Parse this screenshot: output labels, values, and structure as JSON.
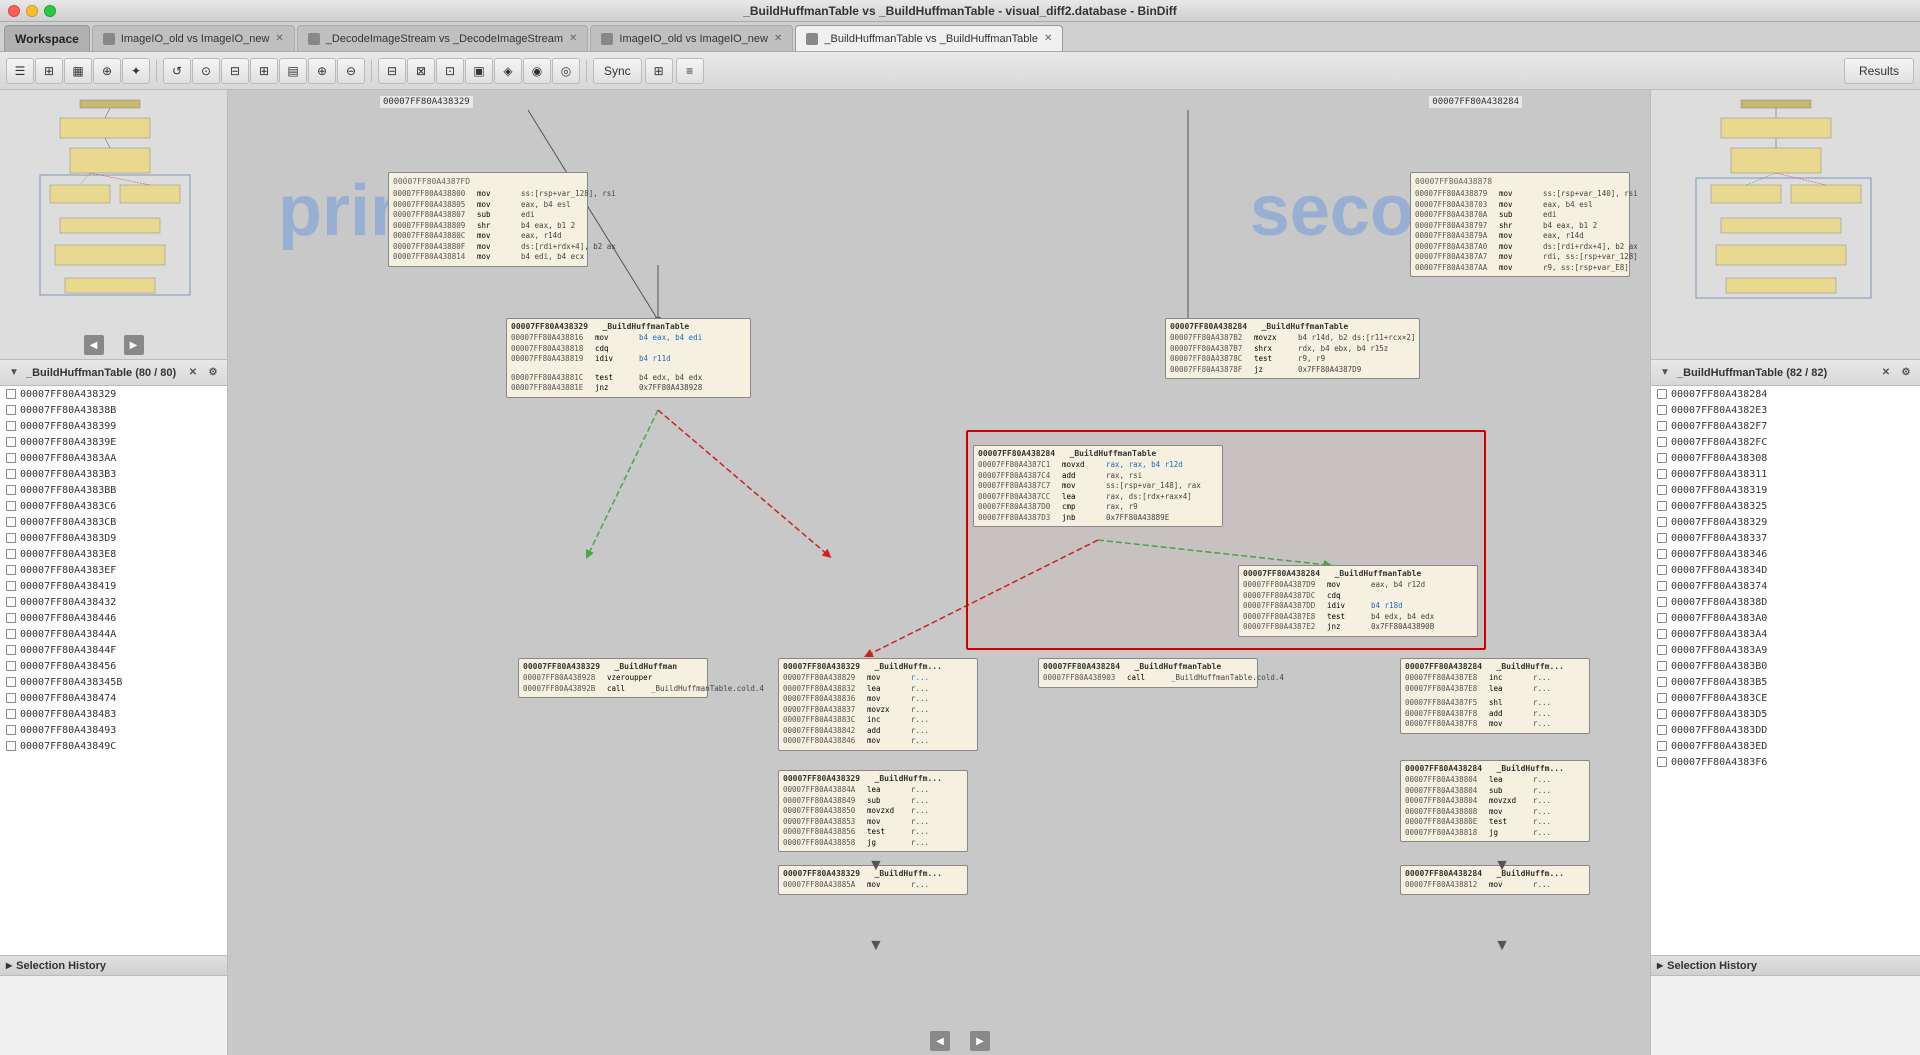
{
  "window": {
    "title": "_BuildHuffmanTable vs _BuildHuffmanTable - visual_diff2.database - BinDiff",
    "controls": {
      "close": "close",
      "minimize": "minimize",
      "maximize": "maximize"
    }
  },
  "tabs": [
    {
      "id": "workspace",
      "label": "Workspace",
      "active": false,
      "closeable": false
    },
    {
      "id": "tab1",
      "label": "ImageIO_old vs ImageIO_new",
      "active": false,
      "closeable": true
    },
    {
      "id": "tab2",
      "label": "_DecodeImageStream vs _DecodeImageStream",
      "active": false,
      "closeable": true
    },
    {
      "id": "tab3",
      "label": "ImageIO_old vs ImageIO_new",
      "active": false,
      "closeable": true
    },
    {
      "id": "tab4",
      "label": "_BuildHuffmanTable vs _BuildHuffmanTable",
      "active": true,
      "closeable": true
    }
  ],
  "toolbar": {
    "sync_label": "Sync",
    "results_label": "Results"
  },
  "left_panel": {
    "list_header": "_BuildHuffmanTable (80 / 80)",
    "items": [
      "00007FF80A438329",
      "00007FF80A43838B",
      "00007FF80A438399",
      "00007FF80A43839E",
      "00007FF80A4383AA",
      "00007FF80A4383B3",
      "00007FF80A4383BB",
      "00007FF80A4383C6",
      "00007FF80A4383CB",
      "00007FF80A4383D9",
      "00007FF80A4383E8",
      "00007FF80A4383EF",
      "00007FF80A438419",
      "00007FF80A438432",
      "00007FF80A438446",
      "00007FF80A43844A",
      "00007FF80A43844F",
      "00007FF80A438456",
      "00007FF80A438345B",
      "00007FF80A438474",
      "00007FF80A438483",
      "00007FF80A438493",
      "00007FF80A43849C"
    ],
    "selection_history_label": "Selection History"
  },
  "right_panel": {
    "list_header": "_BuildHuffmanTable (82 / 82)",
    "items": [
      "00007FF80A438284",
      "00007FF80A4382E3",
      "00007FF80A4382F7",
      "00007FF80A4382FC",
      "00007FF80A438308",
      "00007FF80A438311",
      "00007FF80A438319",
      "00007FF80A438325",
      "00007FF80A438329",
      "00007FF80A438337",
      "00007FF80A438346",
      "00007FF80A43834D",
      "00007FF80A438374",
      "00007FF80A43838D",
      "00007FF80A4383A0",
      "00007FF80A4383A4",
      "00007FF80A4383A9",
      "00007FF80A4383B0",
      "00007FF80A4383B5",
      "00007FF80A4383CE",
      "00007FF80A4383D5",
      "00007FF80A4383DD",
      "00007FF80A4383ED",
      "00007FF80A4383F6"
    ],
    "selection_history_label": "Selection History"
  },
  "graph": {
    "primary_label": "primary",
    "secondary_label": "secondary",
    "left_addr": "00007FF80A438329",
    "right_addr": "00007FF80A438284"
  }
}
